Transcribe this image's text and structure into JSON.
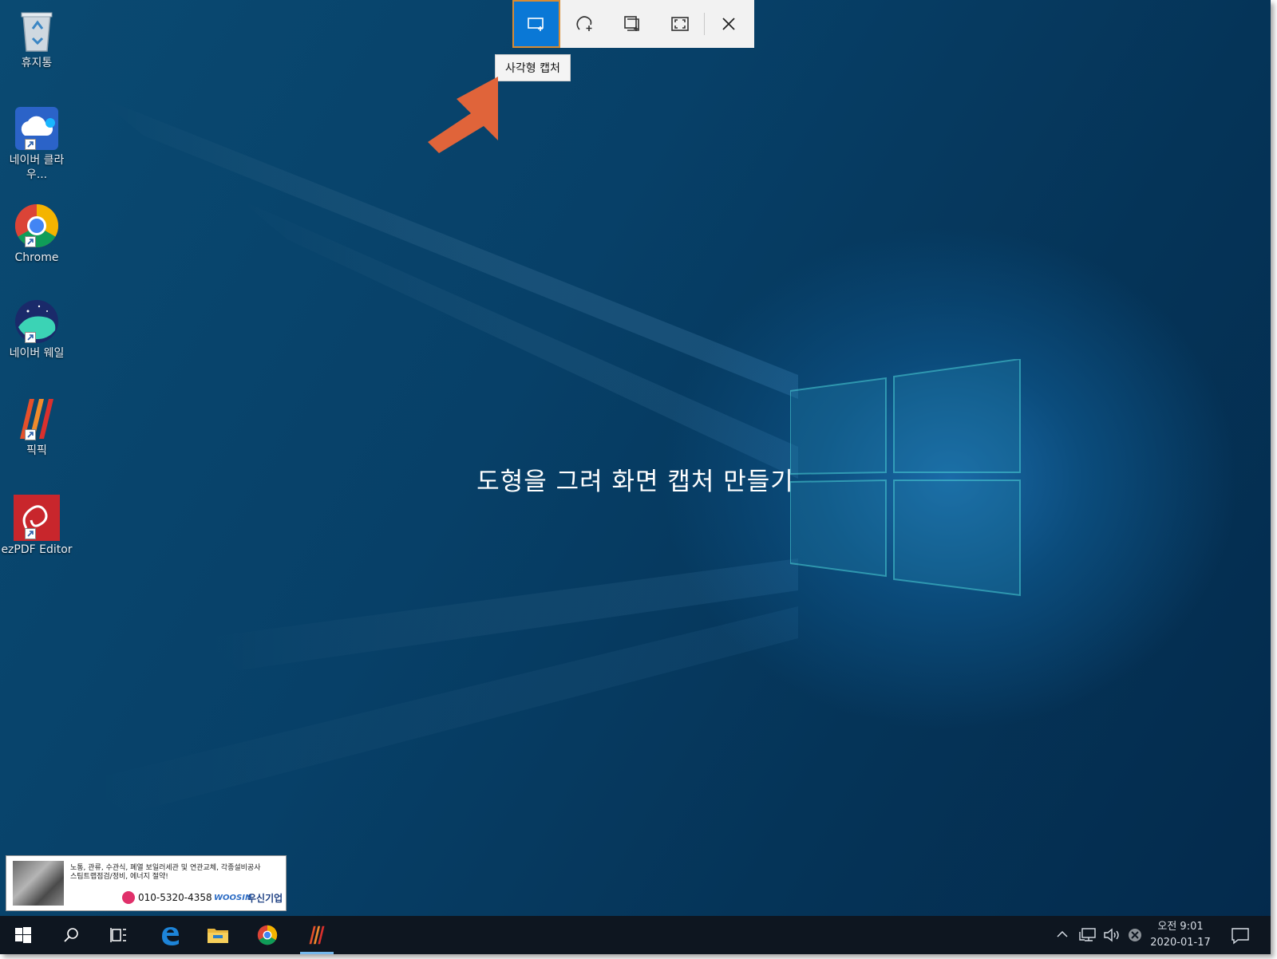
{
  "desktop": {
    "icons": [
      {
        "label": "휴지통",
        "icon": "recycle-bin-icon"
      },
      {
        "label": "네이버 클라우...",
        "icon": "naver-cloud-icon"
      },
      {
        "label": "Chrome",
        "icon": "chrome-icon"
      },
      {
        "label": "네이버 웨일",
        "icon": "naver-whale-icon"
      },
      {
        "label": "픽픽",
        "icon": "picpick-icon"
      },
      {
        "label": "ezPDF Editor",
        "icon": "ezpdf-icon"
      }
    ],
    "center_text": "도형을 그려 화면 캡처 만들기"
  },
  "snip_toolbar": {
    "buttons": [
      {
        "name": "rectangular-snip",
        "icon": "rectangle-snip-icon",
        "active": true
      },
      {
        "name": "freeform-snip",
        "icon": "freeform-snip-icon",
        "active": false
      },
      {
        "name": "window-snip",
        "icon": "window-snip-icon",
        "active": false
      },
      {
        "name": "fullscreen-snip",
        "icon": "fullscreen-snip-icon",
        "active": false
      },
      {
        "name": "close",
        "icon": "close-icon",
        "active": false
      }
    ],
    "tooltip": "사각형 캡처",
    "accent_color": "#0a78d6"
  },
  "annotation": {
    "arrow_color": "#e0643a"
  },
  "ad_banner": {
    "line1": "노통, 관류, 수관식, 폐열 보일러세관 및 연관교체, 각종설비공사",
    "line2": "스팀트랩점검/정비, 에너지 절약!",
    "phone": "010-5320-4358",
    "brand_en": "WOOSIN",
    "brand_ko": "우신기업"
  },
  "taskbar": {
    "items": [
      "start-icon",
      "search-icon",
      "task-view-icon",
      "edge-icon",
      "file-explorer-icon",
      "chrome-icon",
      "picpick-icon"
    ],
    "clock": {
      "period_time": "오전 9:01",
      "date": "2020-01-17"
    }
  }
}
